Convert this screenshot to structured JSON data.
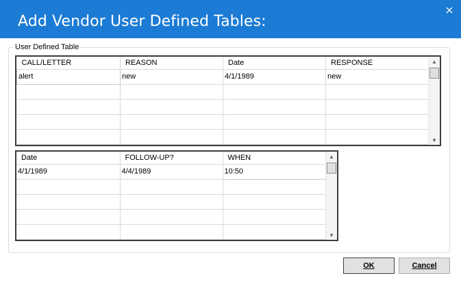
{
  "window": {
    "title": "Add Vendor User Defined Tables:",
    "close_icon": "close-icon"
  },
  "group": {
    "legend": "User Defined Table"
  },
  "grid1": {
    "columns": [
      "CALL/LETTER",
      "REASON",
      "Date",
      "RESPONSE"
    ],
    "rows": [
      [
        "alert",
        "new",
        "4/1/1989",
        "new"
      ],
      [
        "",
        "",
        "",
        ""
      ],
      [
        "",
        "",
        "",
        ""
      ],
      [
        "",
        "",
        "",
        ""
      ],
      [
        "",
        "",
        "",
        ""
      ]
    ]
  },
  "grid2": {
    "columns": [
      "Date",
      "FOLLOW-UP?",
      "WHEN"
    ],
    "rows": [
      [
        "4/1/1989",
        "4/4/1989",
        "10:50"
      ],
      [
        "",
        "",
        ""
      ],
      [
        "",
        "",
        ""
      ],
      [
        "",
        "",
        ""
      ],
      [
        "",
        "",
        ""
      ]
    ]
  },
  "buttons": {
    "ok": "OK",
    "cancel": "Cancel"
  }
}
